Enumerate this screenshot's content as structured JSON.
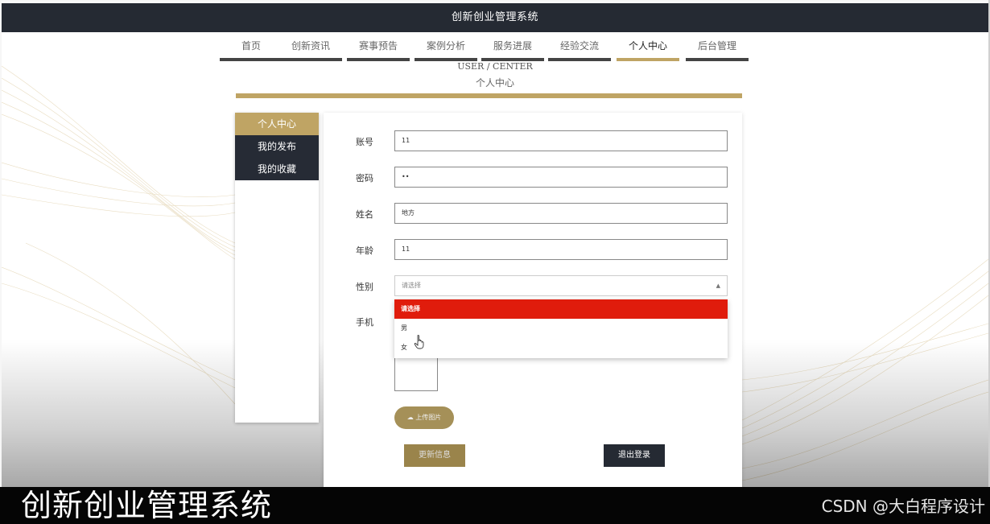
{
  "app": {
    "title": "创新创业管理系统"
  },
  "nav": {
    "items": [
      {
        "label": "首页",
        "active": false
      },
      {
        "label": "创新资讯",
        "active": false
      },
      {
        "label": "赛事预告",
        "active": false
      },
      {
        "label": "案例分析",
        "active": false
      },
      {
        "label": "服务进展",
        "active": false
      },
      {
        "label": "经验交流",
        "active": false
      },
      {
        "label": "个人中心",
        "active": true
      },
      {
        "label": "后台管理",
        "active": false
      }
    ]
  },
  "section": {
    "title_en": "USER / CENTER",
    "title_cn": "个人中心"
  },
  "sidebar": {
    "items": [
      {
        "label": "个人中心",
        "active": true
      },
      {
        "label": "我的发布",
        "active": false
      },
      {
        "label": "我的收藏",
        "active": false
      }
    ]
  },
  "form": {
    "account": {
      "label": "账号",
      "value": "11"
    },
    "password": {
      "label": "密码",
      "value": "••"
    },
    "name": {
      "label": "姓名",
      "value": "地方"
    },
    "age": {
      "label": "年龄",
      "value": "11"
    },
    "gender": {
      "label": "性别",
      "placeholder": "请选择",
      "options": [
        "请选择",
        "男",
        "女"
      ],
      "highlighted": "请选择"
    },
    "phone": {
      "label": "手机"
    },
    "upload_label": "上传图片",
    "update_label": "更新信息",
    "logout_label": "退出登录"
  },
  "overlay": {
    "caption": "创新创业管理系统",
    "watermark": "CSDN @大白程序设计"
  },
  "colors": {
    "accent": "#bfa464",
    "dark": "#252a33",
    "selected_option": "#e01c0c"
  }
}
